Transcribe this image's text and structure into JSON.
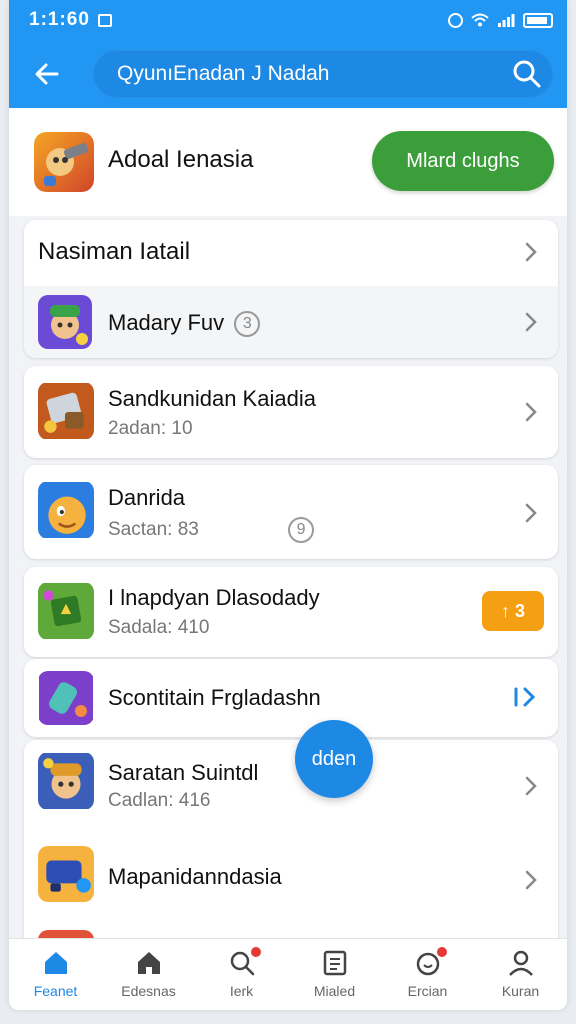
{
  "status_bar": {
    "time": "1:1:60"
  },
  "search": {
    "query": "QyunıEnadan J Nadah"
  },
  "featured": {
    "title": "Adoal Ienasia",
    "button_label": "Mlard clughs"
  },
  "section": {
    "title": "Nasiman Iatail"
  },
  "list": [
    {
      "name": "Madary Fuv",
      "counter": "3"
    },
    {
      "name": "Sandkunidan Kaiadia",
      "sub": "2adan: 10"
    },
    {
      "name": "Danrida",
      "sub": "Sactan:  83",
      "counter": "9"
    },
    {
      "name": "I lnapdyan Dlasodady",
      "sub": "Sadala: 410",
      "badge": "↑ 3"
    },
    {
      "name": "Scontitain Frgladashn"
    },
    {
      "name": "Saratan Suintdl",
      "sub": "Cadlan: 416"
    },
    {
      "name": "Mapanidanndasia"
    }
  ],
  "fab_label": "dden",
  "bottom_nav": [
    {
      "label": "Feanet",
      "icon": "home-icon",
      "active": true
    },
    {
      "label": "Edesnas",
      "icon": "home-icon"
    },
    {
      "label": "Ierk",
      "icon": "search-icon"
    },
    {
      "label": "Mialed",
      "icon": "document-icon"
    },
    {
      "label": "Ercian",
      "icon": "notification-icon"
    },
    {
      "label": "Kuran",
      "icon": "user-icon"
    }
  ],
  "colors": {
    "primary": "#2196f3",
    "accent_green": "#3b9e3b",
    "badge_orange": "#f59f12",
    "notification_red": "#e53935"
  }
}
